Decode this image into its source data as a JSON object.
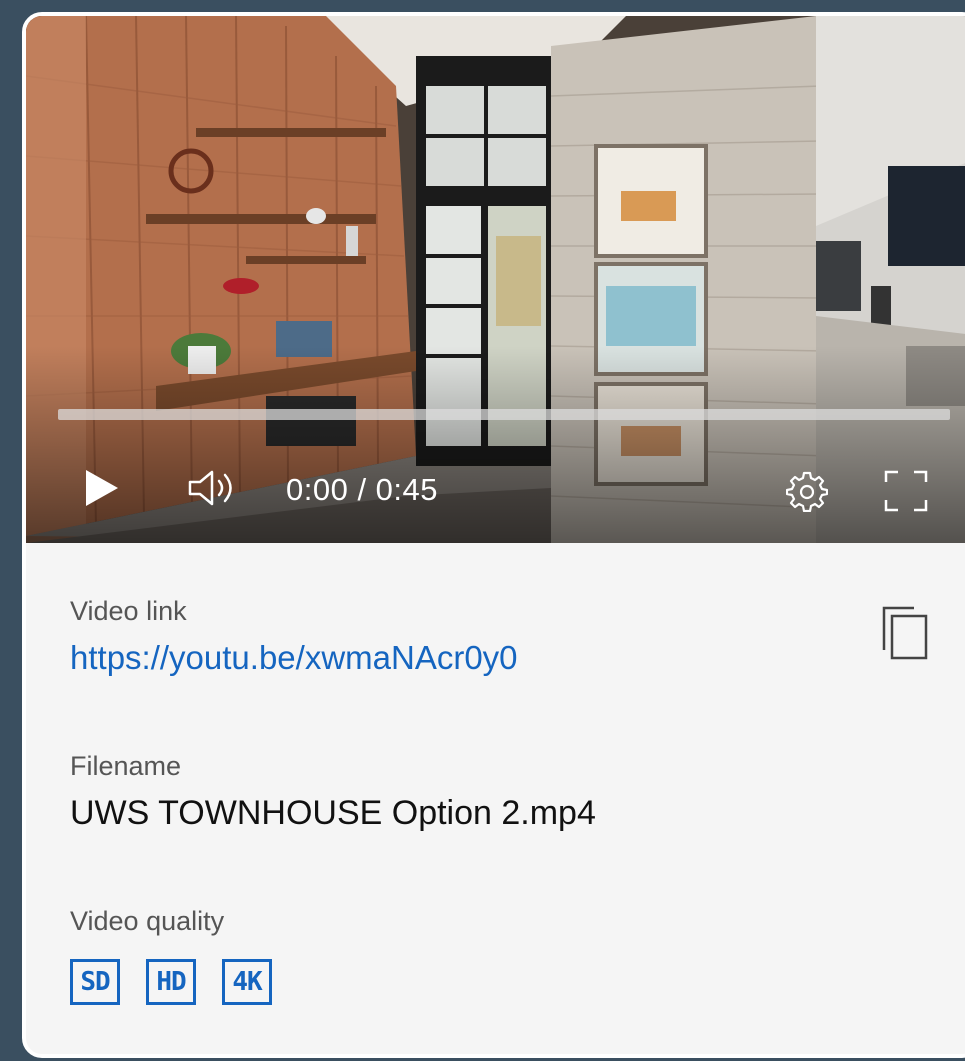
{
  "player": {
    "current_time": "0:00",
    "duration": "0:45",
    "time_text": "0:00 / 0:45",
    "progress_fraction": 0,
    "controls": {
      "play_icon": "play-icon",
      "volume_icon": "volume-icon",
      "settings_icon": "gear-icon",
      "fullscreen_icon": "fullscreen-icon"
    }
  },
  "info": {
    "video_link_label": "Video link",
    "video_link": "https://youtu.be/xwmaNAcr0y0",
    "filename_label": "Filename",
    "filename": "UWS TOWNHOUSE Option 2.mp4",
    "quality_label": "Video quality",
    "qualities": [
      "SD",
      "HD",
      "4K"
    ],
    "copy_icon": "copy-icon"
  },
  "colors": {
    "accent": "#1565c0",
    "background": "#3a4f60",
    "card": "#f5f5f5"
  }
}
